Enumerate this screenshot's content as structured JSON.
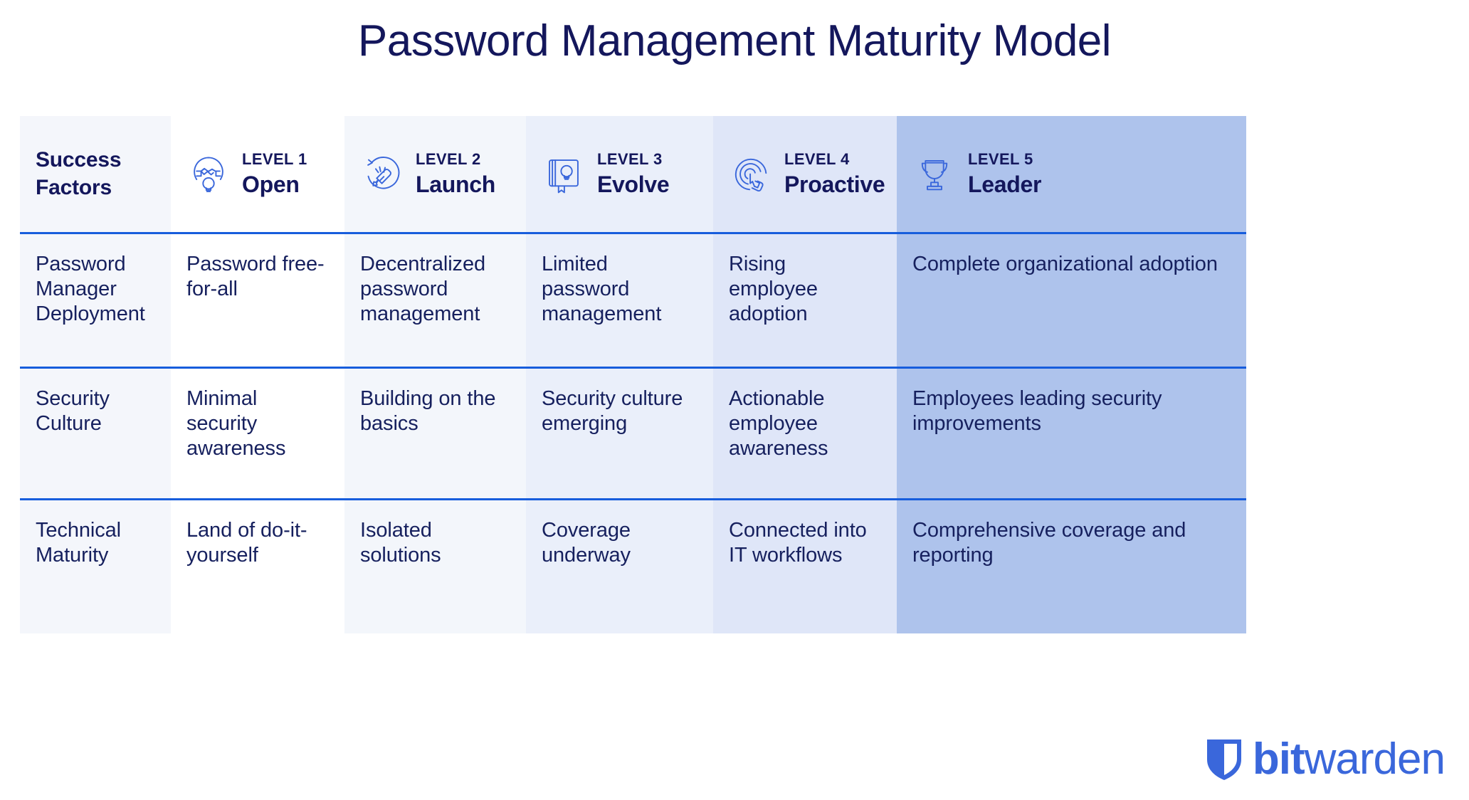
{
  "title": "Password Management Maturity Model",
  "brand": {
    "primary_blue": "#175ddc",
    "navy": "#14175c",
    "logo_blue": "#3a67db",
    "bold_text": "bit",
    "light_text": "warden"
  },
  "table": {
    "header": {
      "first_col_label_line1": "Success",
      "first_col_label_line2": "Factors",
      "levels": [
        {
          "level": "LEVEL 1",
          "name": "Open",
          "icon": "handshake-lightbulb-icon",
          "bg": "#ffffff"
        },
        {
          "level": "LEVEL 2",
          "name": "Launch",
          "icon": "rocket-launch-circle-icon",
          "bg": "#f3f6fb"
        },
        {
          "level": "LEVEL 3",
          "name": "Evolve",
          "icon": "book-lightbulb-icon",
          "bg": "#eaeffa"
        },
        {
          "level": "LEVEL 4",
          "name": "Proactive",
          "icon": "target-tap-icon",
          "bg": "#dfe6f8"
        },
        {
          "level": "LEVEL 5",
          "name": "Leader",
          "icon": "trophy-icon",
          "bg": "#aec3ec"
        }
      ]
    },
    "rows": [
      {
        "factor": "Password Manager Deployment",
        "cells": [
          "Password free-for-all",
          "Decentralized password management",
          "Limited password management",
          "Rising employee adoption",
          "Complete organizational adoption"
        ]
      },
      {
        "factor": "Security Culture",
        "cells": [
          "Minimal security awareness",
          "Building on the basics",
          "Security culture emerging",
          "Actionable employee awareness",
          "Employees leading security improvements"
        ]
      },
      {
        "factor": "Technical Maturity",
        "cells": [
          "Land of do-it-yourself",
          "Isolated solutions",
          "Coverage underway",
          "Connected into IT workflows",
          "Comprehensive coverage and reporting"
        ]
      }
    ]
  }
}
